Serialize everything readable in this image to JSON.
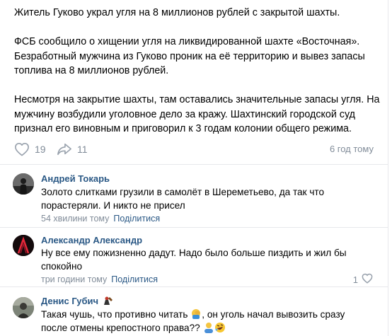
{
  "post": {
    "paragraphs": [
      "Житель Гуково украл угля на 8 миллионов рублей с закрытой шахты.",
      "ФСБ сообщило о хищении угля на ликвидированной шахте «Восточная». Безработный мужчина из Гуково проник на её территорию и вывез запасы топлива на 8 миллионов рублей.",
      "Несмотря на закрытие шахты, там оставались значительные запасы угля. На мужчину возбудили уголовное дело за кражу. Шахтинский городской суд признал его виновным и приговорил к 3 годам колонии общего режима."
    ],
    "likes": "19",
    "shares": "11",
    "time": "6 год тому",
    "like_icon": "heart-icon",
    "share_icon": "share-arrow-icon"
  },
  "comments": [
    {
      "author": "Андрей Токарь",
      "text": "Золото слитками грузили в самолёт в Шереметьево, да так что порастеряли. И никто не присел",
      "time": "54 хвилини тому",
      "reply": "Поділитися"
    },
    {
      "author": "Александр Александр",
      "text": "Ну все ему пожизненно дадут. Надо было больше пиздить и жил бы спокойно",
      "time": "три години тому",
      "reply": "Поділитися",
      "likes": "1"
    },
    {
      "author": "Денис Губич",
      "text_before_emoji": "Такая чушь, что противно читать ",
      "text_after_emoji": ", он уголь начал вывозить сразу после отмены крепостного права?? "
    }
  ],
  "colors": {
    "link": "#2a5885",
    "secondary": "#818c99",
    "divider": "#e7e8ec"
  }
}
